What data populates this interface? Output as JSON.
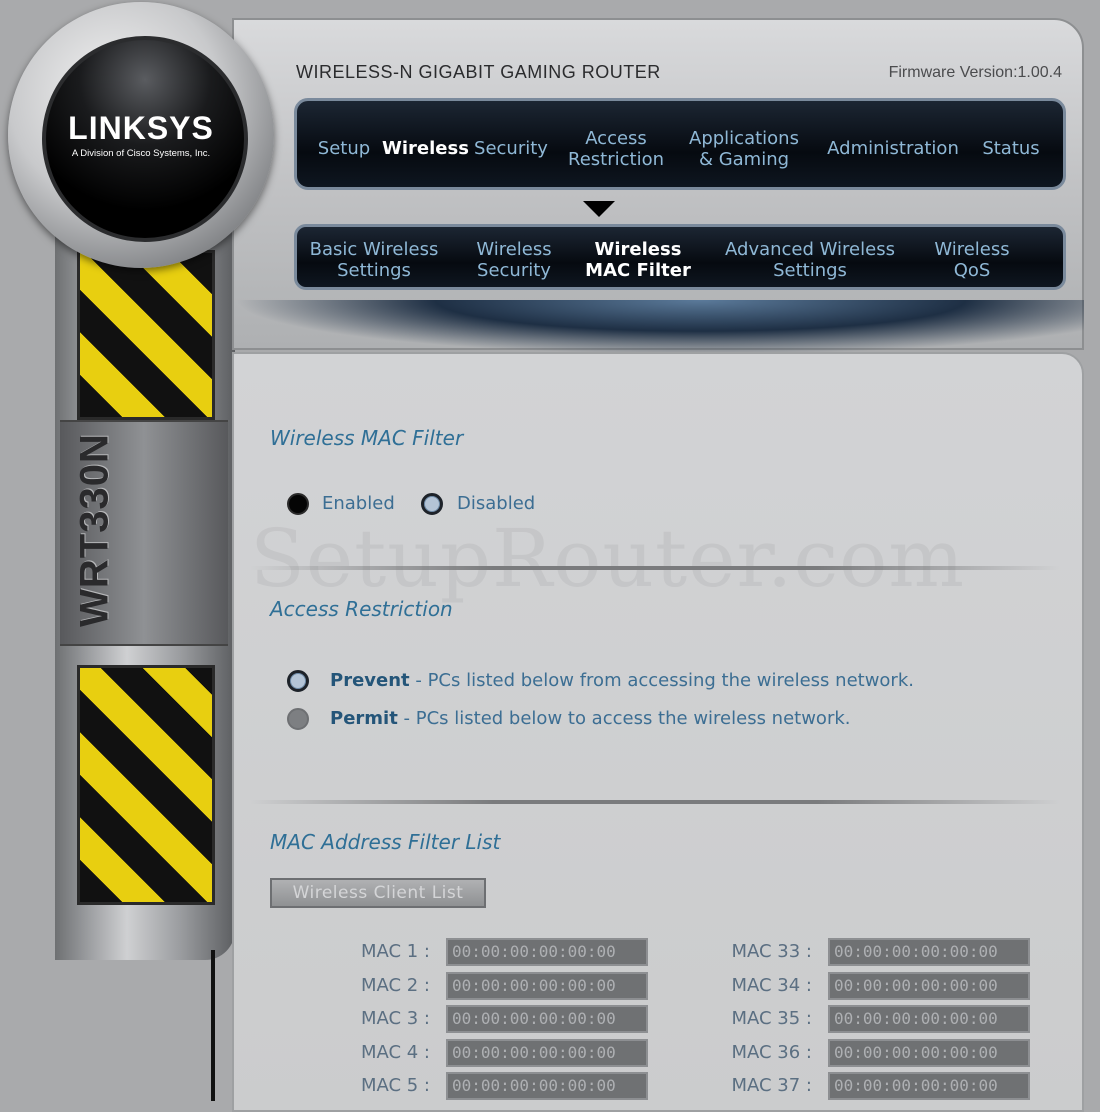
{
  "brand": {
    "logo": "LINKSYS",
    "tagline": "A Division of Cisco Systems, Inc.",
    "model": "WRT330N"
  },
  "header": {
    "product_name": "WIRELESS-N GIGABIT GAMING ROUTER",
    "firmware": "Firmware Version:1.00.4"
  },
  "nav": {
    "items": [
      {
        "label": "Setup"
      },
      {
        "label": "Wireless"
      },
      {
        "label": "Security"
      },
      {
        "label": "Access\nRestriction"
      },
      {
        "label": "Applications\n& Gaming"
      },
      {
        "label": "Administration"
      },
      {
        "label": "Status"
      }
    ],
    "active_index": 1
  },
  "subnav": {
    "items": [
      {
        "label": "Basic Wireless\nSettings"
      },
      {
        "label": "Wireless\nSecurity"
      },
      {
        "label": "Wireless\nMAC Filter"
      },
      {
        "label": "Advanced Wireless\nSettings"
      },
      {
        "label": "Wireless\nQoS"
      }
    ],
    "active_index": 2
  },
  "watermark": "SetupRouter.com",
  "mac_filter": {
    "title": "Wireless MAC Filter",
    "enabled_label": "Enabled",
    "disabled_label": "Disabled",
    "selected": "Disabled"
  },
  "access_restriction": {
    "title": "Access Restriction",
    "prevent_bold": "Prevent",
    "prevent_text": " - PCs listed below from accessing the wireless network.",
    "permit_bold": "Permit",
    "permit_text": " - PCs listed below to access the wireless network.",
    "selected": "Prevent"
  },
  "filter_list": {
    "title": "MAC Address Filter List",
    "client_list_button": "Wireless Client List",
    "left": [
      {
        "label": "MAC 1 :",
        "value": "00:00:00:00:00:00"
      },
      {
        "label": "MAC 2 :",
        "value": "00:00:00:00:00:00"
      },
      {
        "label": "MAC 3 :",
        "value": "00:00:00:00:00:00"
      },
      {
        "label": "MAC 4 :",
        "value": "00:00:00:00:00:00"
      },
      {
        "label": "MAC 5 :",
        "value": "00:00:00:00:00:00"
      }
    ],
    "right": [
      {
        "label": "MAC 33 :",
        "value": "00:00:00:00:00:00"
      },
      {
        "label": "MAC 34 :",
        "value": "00:00:00:00:00:00"
      },
      {
        "label": "MAC 35 :",
        "value": "00:00:00:00:00:00"
      },
      {
        "label": "MAC 36 :",
        "value": "00:00:00:00:00:00"
      },
      {
        "label": "MAC 37 :",
        "value": "00:00:00:00:00:00"
      }
    ]
  },
  "colors": {
    "accent": "#2f6f96",
    "nav_text": "#8fb8d6",
    "stripe_yellow": "#e8cf10"
  }
}
